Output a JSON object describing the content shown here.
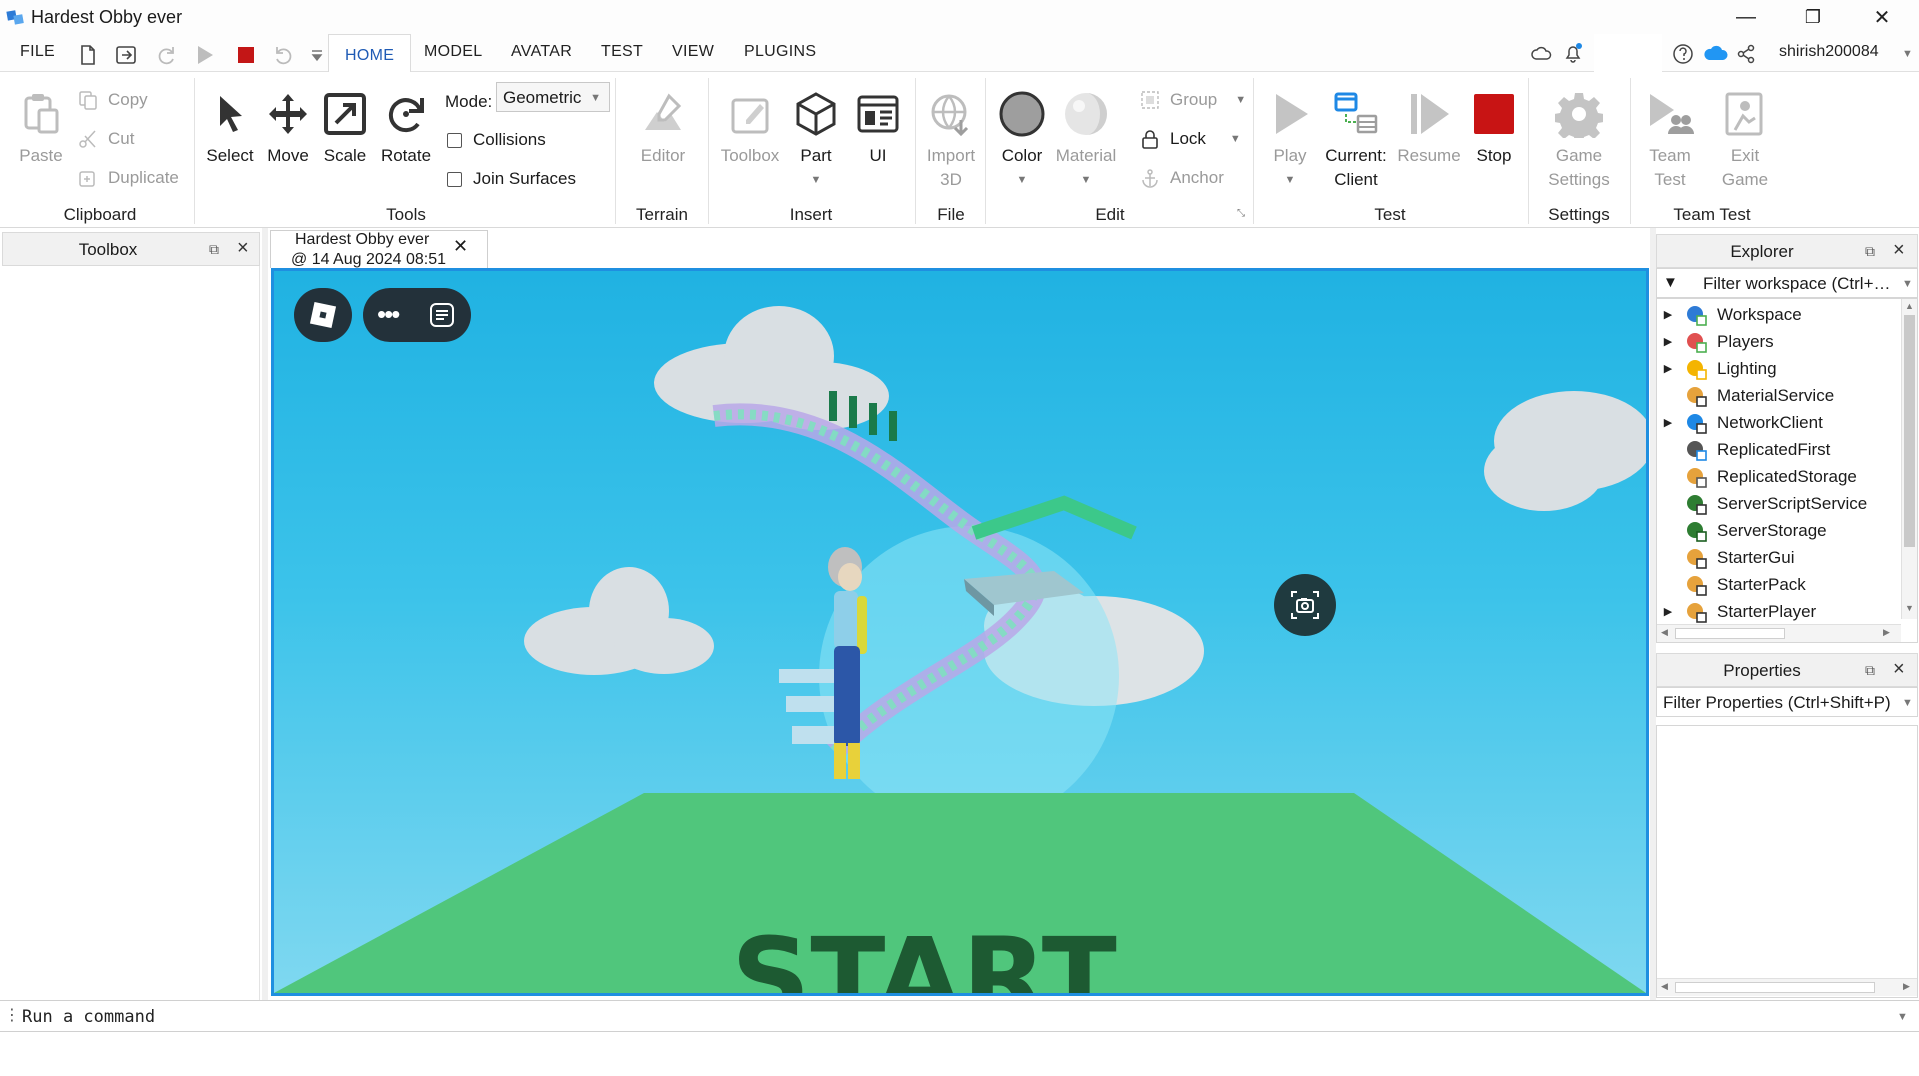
{
  "window": {
    "title": "Hardest Obby ever",
    "minimize": "—",
    "restore": "❐",
    "close": "✕"
  },
  "menu": {
    "file": "FILE",
    "tabs": [
      "HOME",
      "MODEL",
      "AVATAR",
      "TEST",
      "VIEW",
      "PLUGINS"
    ],
    "active_tab": "HOME",
    "username": "shirish200084"
  },
  "ribbon": {
    "clipboard": {
      "label": "Clipboard",
      "paste": "Paste",
      "copy": "Copy",
      "cut": "Cut",
      "duplicate": "Duplicate"
    },
    "tools": {
      "label": "Tools",
      "select": "Select",
      "move": "Move",
      "scale": "Scale",
      "rotate": "Rotate",
      "mode_label": "Mode:",
      "mode_value": "Geometric",
      "collisions": "Collisions",
      "join_surfaces": "Join Surfaces"
    },
    "terrain": {
      "label": "Terrain",
      "editor": "Editor"
    },
    "insert": {
      "label": "Insert",
      "toolbox": "Toolbox",
      "part": "Part",
      "ui": "UI"
    },
    "file": {
      "label": "File",
      "import_3d_line1": "Import",
      "import_3d_line2": "3D"
    },
    "edit": {
      "label": "Edit",
      "color": "Color",
      "material": "Material",
      "group": "Group",
      "lock": "Lock",
      "anchor": "Anchor"
    },
    "test": {
      "label": "Test",
      "play": "Play",
      "current_client_line1": "Current:",
      "current_client_line2": "Client",
      "resume": "Resume",
      "stop": "Stop"
    },
    "settings": {
      "label": "Settings",
      "game_settings_line1": "Game",
      "game_settings_line2": "Settings"
    },
    "team_test": {
      "label": "Team Test",
      "team_test_line1": "Team",
      "team_test_line2": "Test",
      "exit_game_line1": "Exit",
      "exit_game_line2": "Game"
    }
  },
  "toolbox": {
    "title": "Toolbox"
  },
  "document_tab": {
    "line1": "Hardest Obby ever",
    "line2": "@ 14 Aug 2024 08:51"
  },
  "viewport": {
    "start_text": "START"
  },
  "explorer": {
    "title": "Explorer",
    "filter_placeholder": "Filter workspace (Ctrl+…",
    "items": [
      {
        "label": "Workspace",
        "expandable": true,
        "icon": "globe-icon"
      },
      {
        "label": "Players",
        "expandable": true,
        "icon": "players-icon"
      },
      {
        "label": "Lighting",
        "expandable": true,
        "icon": "lightbulb-icon"
      },
      {
        "label": "MaterialService",
        "expandable": false,
        "icon": "material-service-icon"
      },
      {
        "label": "NetworkClient",
        "expandable": true,
        "icon": "network-icon"
      },
      {
        "label": "ReplicatedFirst",
        "expandable": false,
        "icon": "replicated-first-icon"
      },
      {
        "label": "ReplicatedStorage",
        "expandable": false,
        "icon": "replicated-storage-icon"
      },
      {
        "label": "ServerScriptService",
        "expandable": false,
        "icon": "server-script-icon"
      },
      {
        "label": "ServerStorage",
        "expandable": false,
        "icon": "server-storage-icon"
      },
      {
        "label": "StarterGui",
        "expandable": false,
        "icon": "starter-gui-icon"
      },
      {
        "label": "StarterPack",
        "expandable": false,
        "icon": "starter-pack-icon"
      },
      {
        "label": "StarterPlayer",
        "expandable": true,
        "icon": "starter-player-icon"
      }
    ]
  },
  "properties": {
    "title": "Properties",
    "filter_placeholder": "Filter Properties (Ctrl+Shift+P)"
  },
  "command_bar": {
    "placeholder": "Run a command"
  }
}
